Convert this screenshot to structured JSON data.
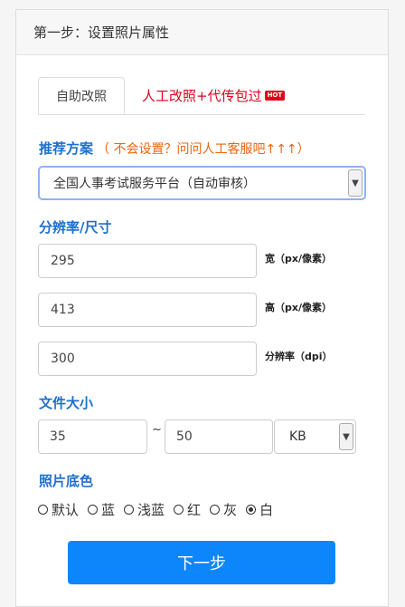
{
  "header": {
    "title": "第一步：设置照片属性"
  },
  "tabs": {
    "active_label": "自助改照",
    "other_label": "人工改照+代传包过",
    "hot_badge": "HOT"
  },
  "preset": {
    "title": "推荐方案",
    "hint": "（ 不会设置？问问人工客服吧↑↑↑）",
    "selected": "全国人事考试服务平台（自动审核）"
  },
  "resolution": {
    "title": "分辨率/尺寸",
    "width": {
      "value": "295",
      "label": "宽（px/像素）"
    },
    "height": {
      "value": "413",
      "label": "高（px/像素）"
    },
    "dpi": {
      "value": "300",
      "label": "分辨率（dpi）"
    }
  },
  "filesize": {
    "title": "文件大小",
    "min": "35",
    "separator": "~",
    "max": "50",
    "unit": "KB"
  },
  "background": {
    "title": "照片底色",
    "options": [
      "默认",
      "蓝",
      "浅蓝",
      "红",
      "灰",
      "白"
    ],
    "selected": "白"
  },
  "next_button": "下一步",
  "colors": {
    "accent": "#1e6fd0",
    "hint": "#f0630f",
    "hot": "#e0001b",
    "button": "#0e86fb"
  }
}
